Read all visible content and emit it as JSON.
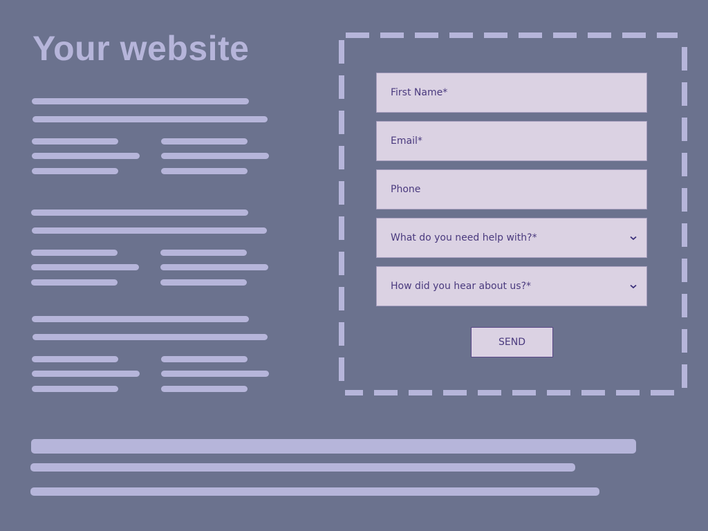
{
  "page": {
    "title": "Your website",
    "colors": {
      "background": "#6b728e",
      "placeholder_bar": "#b6b5da",
      "field_background": "#dbd2e3",
      "text": "#4a3a7e"
    }
  },
  "form": {
    "fields": [
      {
        "label": "First Name*",
        "type": "text"
      },
      {
        "label": "Email*",
        "type": "text"
      },
      {
        "label": "Phone",
        "type": "text"
      },
      {
        "label": "What do you need help with?*",
        "type": "select",
        "icon": "chevron-down-icon"
      },
      {
        "label": "How did you hear about us?*",
        "type": "select",
        "icon": "chevron-down-icon"
      }
    ],
    "submit_label": "SEND"
  }
}
